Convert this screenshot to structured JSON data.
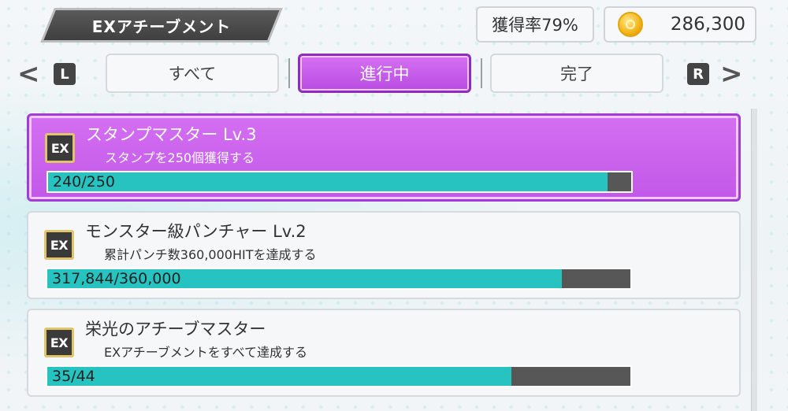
{
  "header": {
    "title": "EXアチーブメント",
    "rate_text": "獲得率79%",
    "coins": "286,300"
  },
  "tabs": [
    {
      "label": "すべて",
      "active": false
    },
    {
      "label": "進行中",
      "active": true
    },
    {
      "label": "完了",
      "active": false
    }
  ],
  "nav": {
    "left_arrow": "<",
    "right_arrow": ">",
    "left_key": "L",
    "right_key": "R"
  },
  "achievements": [
    {
      "badge": "EX",
      "title": "スタンプマスター Lv.3",
      "description": "スタンプを250個獲得する",
      "progress_text": "240/250",
      "current": 240,
      "total": 250,
      "selected": true
    },
    {
      "badge": "EX",
      "title": "モンスター級パンチャー Lv.2",
      "description": "累計パンチ数360,000HITを達成する",
      "progress_text": "317,844/360,000",
      "current": 317844,
      "total": 360000,
      "selected": false
    },
    {
      "badge": "EX",
      "title": "栄光のアチーブマスター",
      "description": "EXアチーブメントをすべて達成する",
      "progress_text": "35/44",
      "current": 35,
      "total": 44,
      "selected": false
    }
  ],
  "colors": {
    "accent": "#c258e8",
    "progress": "#27c3c0",
    "track": "#575757"
  }
}
